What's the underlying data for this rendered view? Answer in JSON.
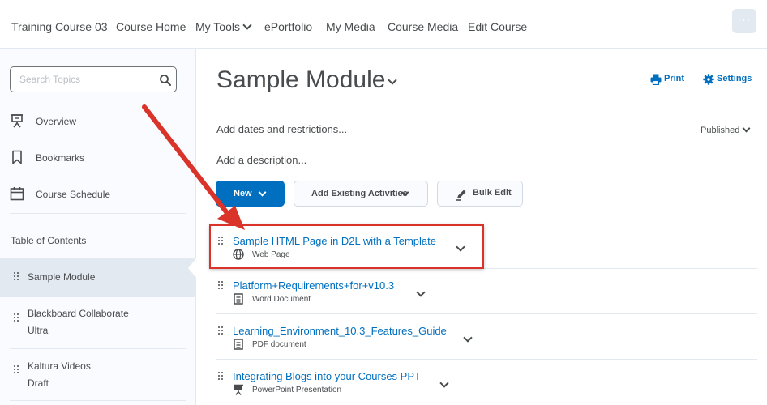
{
  "topnav": {
    "items": [
      {
        "label": "Training Course 03"
      },
      {
        "label": "Course Home"
      },
      {
        "label": "My Tools"
      },
      {
        "label": "ePortfolio"
      },
      {
        "label": "My Media"
      },
      {
        "label": "Course Media"
      },
      {
        "label": "Edit Course"
      }
    ],
    "more_label": "···"
  },
  "sidebar": {
    "search_placeholder": "Search Topics",
    "nav": [
      {
        "label": "Overview",
        "icon": "overview-icon"
      },
      {
        "label": "Bookmarks",
        "icon": "bookmark-icon"
      },
      {
        "label": "Course Schedule",
        "icon": "calendar-icon"
      }
    ],
    "toc_heading": "Table of Contents",
    "toc": [
      {
        "label": "Sample Module",
        "selected": true
      },
      {
        "label": "Blackboard Collaborate",
        "sublabel": "Ultra"
      },
      {
        "label": "Kaltura Videos",
        "sublabel": "Draft"
      }
    ]
  },
  "main": {
    "module_title": "Sample Module",
    "print_label": "Print",
    "settings_label": "Settings",
    "dates_label": "Add dates and restrictions...",
    "status_label": "Published",
    "description_label": "Add a description...",
    "buttons": {
      "new_label": "New",
      "existing_label": "Add Existing Activities",
      "bulk_label": "Bulk Edit"
    },
    "topics": [
      {
        "title": "Sample HTML Page in D2L with a Template",
        "type": "Web Page",
        "icon": "globe-icon",
        "highlighted": true
      },
      {
        "title": "Platform+Requirements+for+v10.3",
        "type": "Word Document",
        "icon": "document-icon"
      },
      {
        "title": "Learning_Environment_10.3_Features_Guide",
        "type": "PDF document",
        "icon": "document-icon"
      },
      {
        "title": "Integrating Blogs into your Courses PPT",
        "type": "PowerPoint Presentation",
        "icon": "presentation-icon"
      }
    ]
  },
  "colors": {
    "link": "#006fbf",
    "primary_button": "#006fbf",
    "highlight": "#d9332a",
    "text": "#494c4e",
    "sidebar_bg": "#f9fbff"
  }
}
